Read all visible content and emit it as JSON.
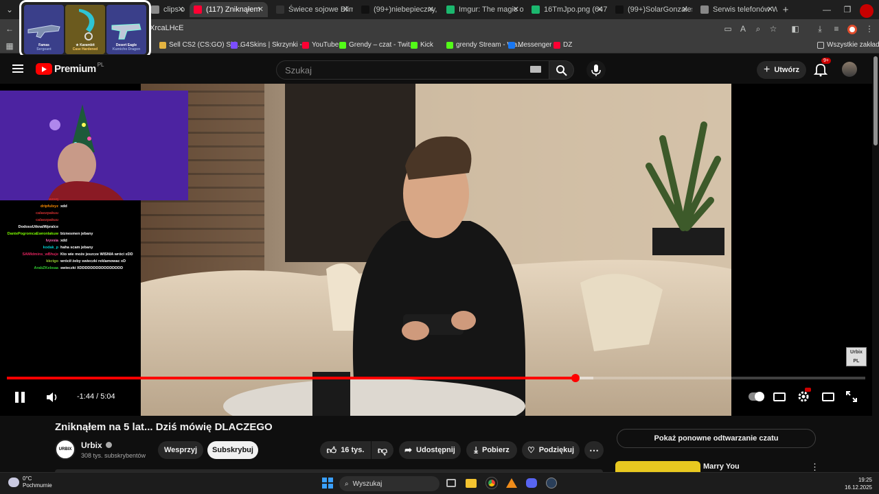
{
  "tabs": [
    {
      "label": "clips o",
      "fav": "#8a8a8a"
    },
    {
      "label": "(117) Zniknąłem",
      "fav": "#ff0033"
    },
    {
      "label": "Świece sojowe Blim",
      "fav": "#333333"
    },
    {
      "label": "(99+)niebepieczny, l",
      "fav": "#111111"
    },
    {
      "label": "Imgur: The magic of",
      "fav": "#1bb76e"
    },
    {
      "label": "16TmJpo.png (647×5",
      "fav": "#1bb76e"
    },
    {
      "label": "(99+)SolarGonzales",
      "fav": "#111111"
    },
    {
      "label": "Serwis telefonów We",
      "fav": "#888888"
    }
  ],
  "address": {
    "value": "XrcaLHcE"
  },
  "bookmarks": [
    {
      "label": "Sell CS2 (CS:GO) Ski...",
      "color": "#e3b341"
    },
    {
      "label": "G4Skins | Skrzynki -...",
      "color": "#7b4dff"
    },
    {
      "label": "YouTube",
      "color": "#ff0033"
    },
    {
      "label": "Grendy – czat - Twit...",
      "color": "#53fc18"
    },
    {
      "label": "Kick",
      "color": "#53fc18"
    },
    {
      "label": "grendy Stream - Wa...",
      "color": "#53fc18"
    },
    {
      "label": "Messenger",
      "color": "#1877f2"
    },
    {
      "label": "DZ",
      "color": "#ff0033"
    }
  ],
  "bookmarks_all": "Wszystkie zakładki",
  "promo": {
    "items": [
      {
        "name": "Famas",
        "sub": "Sergeant",
        "bg": "#3a3f8a"
      },
      {
        "name": "★ Karambit",
        "sub": "Case Hardened",
        "bg": "#6b5a1e"
      },
      {
        "name": "Desert Eagle",
        "sub": "Kumicho Dragon",
        "bg": "#3a3f8a"
      }
    ]
  },
  "yt": {
    "logo": "Premium",
    "region": "PL",
    "search_placeholder": "Szukaj",
    "create_label": "Utwórz",
    "notif_count": "9+"
  },
  "chat": [
    {
      "user": "wxvq",
      "msg": "",
      "color": "#d03030"
    },
    {
      "user": "dripfulxyz",
      "msg": "xdd",
      "color": "#ff8c00"
    },
    {
      "user": "calaozpakuu",
      "msg": "",
      "color": "#d03030"
    },
    {
      "user": "calaozpakuu",
      "msg": "",
      "color": "#d03030"
    },
    {
      "user": "DodossUtknalWpralce",
      "msg": "",
      "color": "#ffffff"
    },
    {
      "user": "DantePogromcaEwronlakuw",
      "msg": "biznesmen jebany",
      "color": "#7cfc00"
    },
    {
      "user": "lvyvsia",
      "msg": "xdd",
      "color": "#ff69b4"
    },
    {
      "user": "kodak_p",
      "msg": "haha scam jebany",
      "color": "#00ced1"
    },
    {
      "user": "SAMIdmins_wBhuje",
      "msg": "Kto wie może jeszcze WISNIA wróci xDD",
      "color": "#e0245e"
    },
    {
      "user": "kkctgo",
      "msg": "wrócił żeby swieczki reklamowac xD",
      "color": "#9acd32"
    },
    {
      "user": "ArabZKebsaa",
      "msg": "swieczki XDDDDDDDDDDDDDDDD",
      "color": "#32cd32"
    }
  ],
  "player": {
    "time": "-1:44 / 5:04",
    "played_fraction": 0.662,
    "buffered_fraction": 0.683,
    "watermark": "Urbix PL"
  },
  "video": {
    "title": "Zniknąłem na 5 lat... Dziś mówię DLACZEGO",
    "channel": "Urbix",
    "subscribers": "308 tys. subskrybentów",
    "avatar_text": "URBIX",
    "support_label": "Wesprzyj",
    "subscribe_label": "Subskrybuj",
    "likes": "16 tys.",
    "share_label": "Udostępnij",
    "download_label": "Pobierz",
    "thanks_label": "Podziękuj"
  },
  "side": {
    "chat_replay": "Pokaż ponowne odtwarzanie czatu",
    "next_title": "Marry You"
  },
  "taskbar": {
    "temp": "0°C",
    "weather": "Pochmurnie",
    "search": "Wyszukaj",
    "time": "19:25",
    "date": "16.12.2025"
  }
}
